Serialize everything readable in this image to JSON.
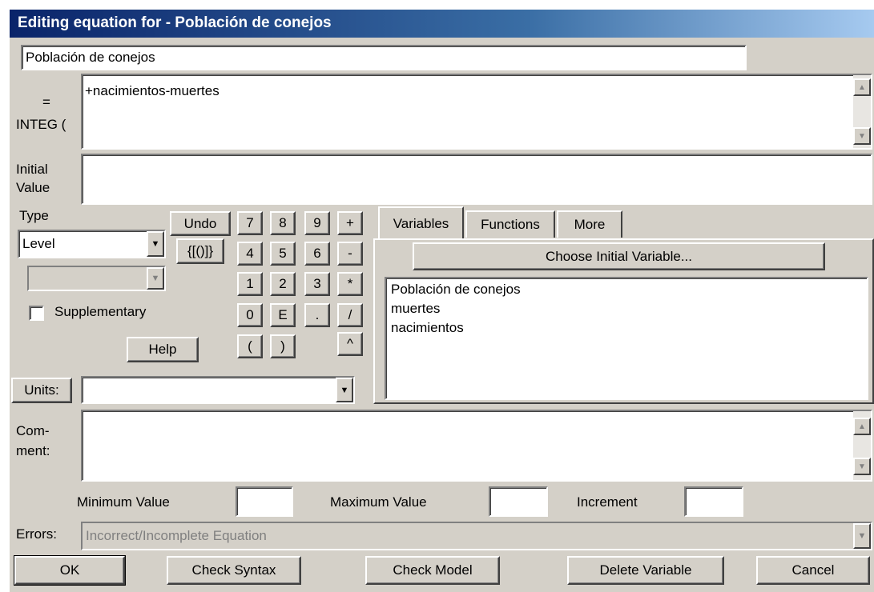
{
  "window": {
    "title": "Editing equation for - Población de conejos"
  },
  "name_field": {
    "value": "Población de conejos"
  },
  "equation": {
    "label_eq": "=",
    "label_integ": "INTEG (",
    "value": "+nacimientos-muertes"
  },
  "initial_value": {
    "label_line1": "Initial",
    "label_line2": "Value",
    "value": ""
  },
  "type": {
    "label": "Type",
    "selected": "Level",
    "sub_selected": ""
  },
  "supplementary": {
    "label": "Supplementary",
    "checked": false
  },
  "buttons": {
    "undo": "Undo",
    "braces": "{[()]}",
    "help": "Help",
    "units": "Units:",
    "choose_initial_variable": "Choose Initial Variable...",
    "ok": "OK",
    "check_syntax": "Check Syntax",
    "check_model": "Check Model",
    "delete_variable": "Delete Variable",
    "cancel": "Cancel"
  },
  "keypad": [
    "7",
    "8",
    "9",
    "+",
    "4",
    "5",
    "6",
    "-",
    "1",
    "2",
    "3",
    "*",
    "0",
    "E",
    ".",
    "/",
    "(",
    ")",
    "^"
  ],
  "tabs": [
    "Variables",
    "Functions",
    "More"
  ],
  "variables_list": [
    "Población de conejos",
    "muertes",
    "nacimientos"
  ],
  "units": {
    "value": ""
  },
  "comment": {
    "label_line1": "Com-",
    "label_line2": "ment:",
    "value": ""
  },
  "range": {
    "min_label": "Minimum Value",
    "min_value": "",
    "max_label": "Maximum Value",
    "max_value": "",
    "inc_label": "Increment",
    "inc_value": ""
  },
  "errors": {
    "label": "Errors:",
    "value": "Incorrect/Incomplete Equation"
  },
  "colors": {
    "titlebar_start": "#0a246a",
    "face": "#d4d0c8",
    "disabled_text": "#808080"
  }
}
